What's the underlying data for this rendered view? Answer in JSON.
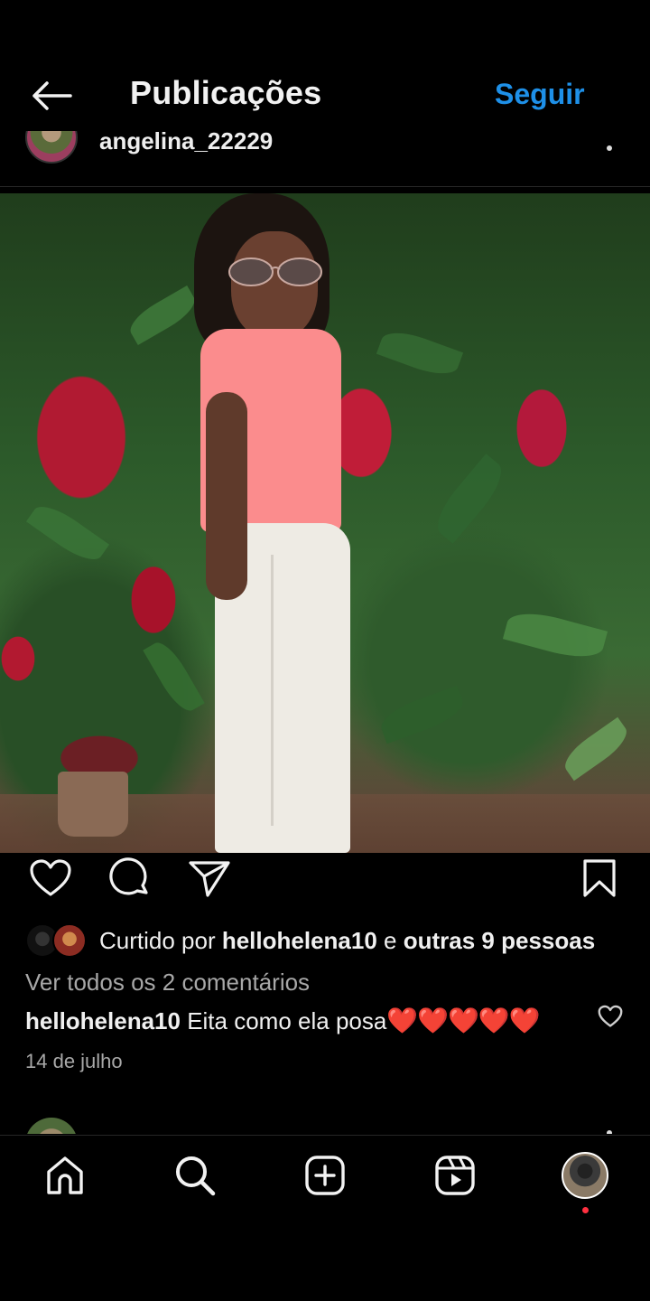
{
  "header": {
    "title": "Publicações",
    "follow_label": "Seguir"
  },
  "post": {
    "username": "angelina_22229",
    "likes": {
      "prefix": "Curtido por ",
      "user": "hellohelena10",
      "middle": " e ",
      "others": "outras 9 pessoas"
    },
    "view_comments": "Ver todos os 2 comentários",
    "comment": {
      "user": "hellohelena10",
      "text": " Eita como ela posa",
      "emojis": "❤️❤️❤️❤️❤️"
    },
    "date": "14 de julho"
  },
  "icons": {
    "back": "arrow-left-icon",
    "like": "heart-icon",
    "comment": "comment-icon",
    "share": "paper-plane-icon",
    "save": "bookmark-icon",
    "home": "home-icon",
    "search": "search-icon",
    "create": "plus-square-icon",
    "reels": "reels-icon"
  },
  "colors": {
    "background": "#000000",
    "accent": "#1e90e8",
    "notification": "#ff3040",
    "secondary_text": "#a8a8a8"
  }
}
